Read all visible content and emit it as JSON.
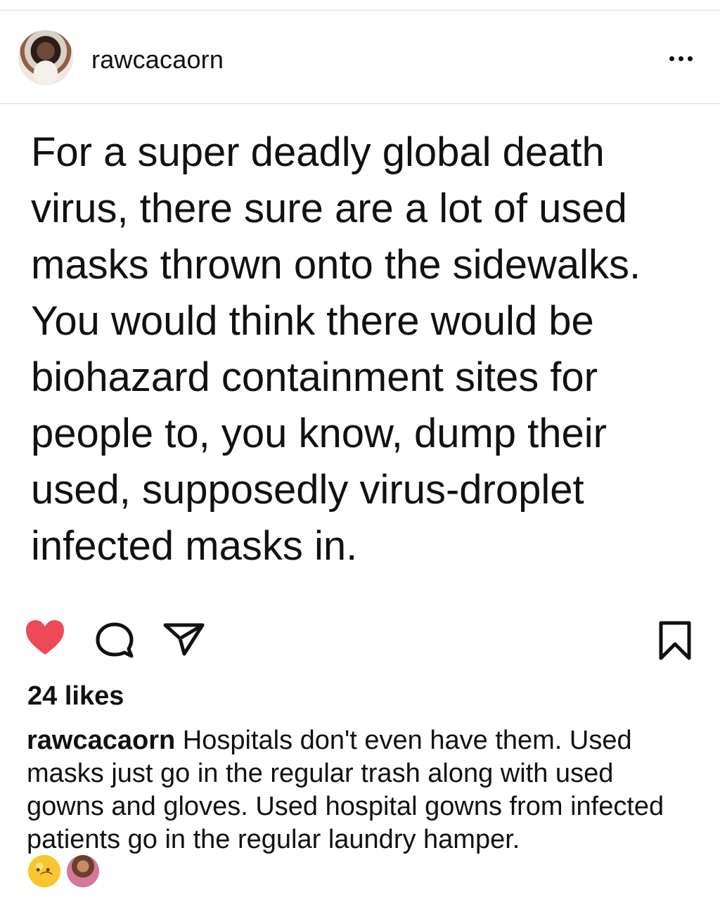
{
  "post": {
    "username": "rawcacaorn",
    "text": "For a super deadly global death virus, there sure are a lot of used masks thrown onto the sidewalks. You would think there would be biohazard containment sites for people to, you know, dump their used, supposedly virus-droplet infected masks in.",
    "likes": "24 likes",
    "caption_user": "rawcacaorn",
    "caption": " Hospitals don't even have them. Used masks just go in the regular trash along with used gowns and gloves. Used hospital gowns from infected patients go in the regular laundry hamper.",
    "emojis": [
      "thinking-face-emoji",
      "person-shrugging-emoji"
    ]
  },
  "icons": {
    "more": "more-options-icon",
    "heart": "heart-icon",
    "comment": "comment-icon",
    "share": "share-icon",
    "bookmark": "bookmark-icon"
  },
  "colors": {
    "like": "#ed4956",
    "text": "#111111",
    "divider": "#dbdbdb"
  }
}
